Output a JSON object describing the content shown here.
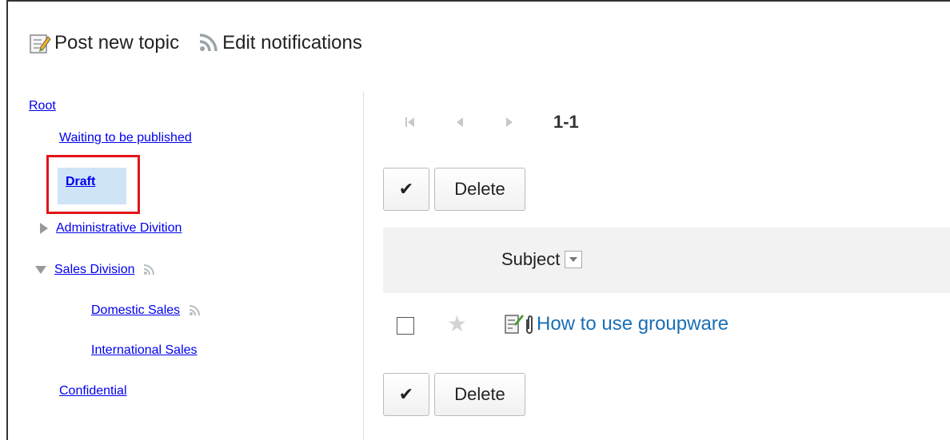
{
  "toolbar": {
    "post_label": "Post new topic",
    "notify_label": "Edit notifications"
  },
  "tree": {
    "root": "Root",
    "waiting": "Waiting to be published",
    "draft": "Draft",
    "admin": "Administrative Divition",
    "sales": "Sales Division",
    "domestic": "Domestic Sales",
    "international": "International Sales",
    "confidential": "Confidential"
  },
  "pager": {
    "range": "1-1"
  },
  "actions": {
    "check_symbol": "✔",
    "delete_label": "Delete"
  },
  "list": {
    "subject_header": "Subject",
    "rows": [
      {
        "title": "How to use groupware",
        "starred": false,
        "has_attachment": true
      }
    ]
  },
  "colors": {
    "link": "#1a6fb5",
    "highlight_border": "#e2141a",
    "selected_bg": "#cfe5f7"
  },
  "icons": [
    "post-topic-icon",
    "rss-icon",
    "caret-right-icon",
    "caret-down-icon",
    "first-page-icon",
    "prev-page-icon",
    "next-page-icon",
    "star-icon",
    "memo-icon",
    "attachment-icon"
  ]
}
